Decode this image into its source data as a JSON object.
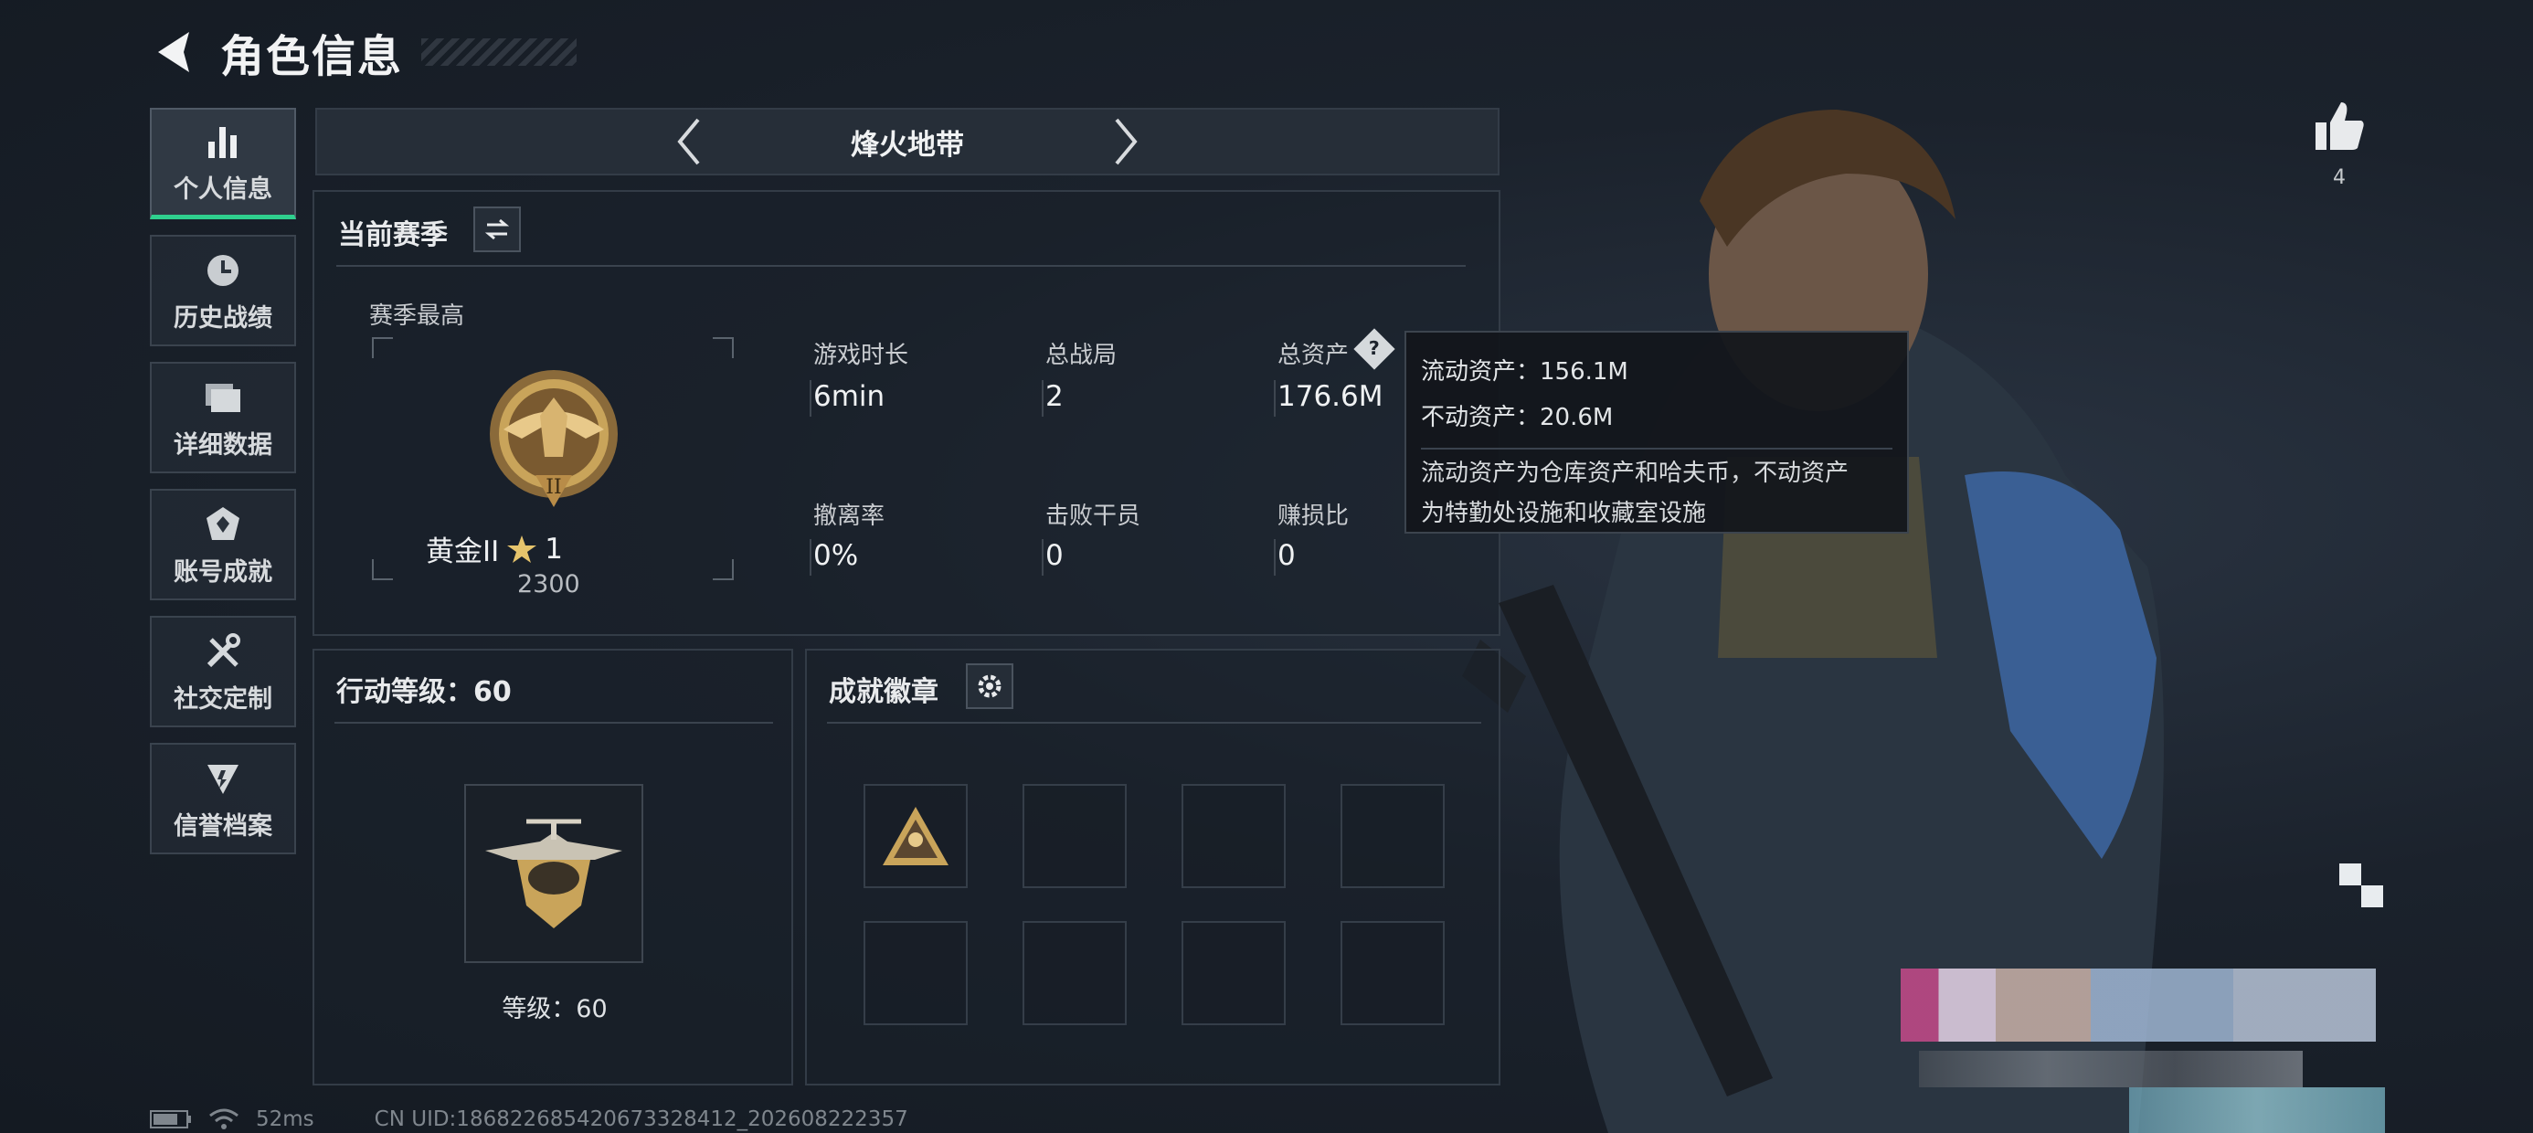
{
  "header": {
    "title": "角色信息"
  },
  "sidebar": {
    "items": [
      {
        "label": "个人信息",
        "icon": "bar-chart-icon",
        "active": true
      },
      {
        "label": "历史战绩",
        "icon": "history-clock-icon",
        "active": false
      },
      {
        "label": "详细数据",
        "icon": "folder-icon",
        "active": false
      },
      {
        "label": "账号成就",
        "icon": "achievement-icon",
        "active": false
      },
      {
        "label": "社交定制",
        "icon": "tools-icon",
        "active": false
      },
      {
        "label": "信誉档案",
        "icon": "credit-shield-icon",
        "active": false
      }
    ]
  },
  "mode": {
    "label": "烽火地带"
  },
  "season": {
    "title": "当前赛季",
    "best_label": "赛季最高",
    "rank_name": "黄金II",
    "rank_stars": "1",
    "rank_score": "2300",
    "stats": [
      {
        "label": "游戏时长",
        "value": "6min"
      },
      {
        "label": "总战局",
        "value": "2"
      },
      {
        "label": "总资产",
        "value": "176.6M"
      },
      {
        "label": "撤离率",
        "value": "0%"
      },
      {
        "label": "击败干员",
        "value": "0"
      },
      {
        "label": "赚损比",
        "value": "0"
      }
    ]
  },
  "tooltip": {
    "liquid": "流动资产：156.1M",
    "fixed": "不动资产：20.6M",
    "desc_line1": "流动资产为仓库资产和哈夫币，不动资产",
    "desc_line2": "为特勤处设施和收藏室设施"
  },
  "level": {
    "title": "行动等级：60",
    "caption": "等级：60"
  },
  "badges": {
    "title": "成就徽章"
  },
  "likes": {
    "count": "4"
  },
  "footer": {
    "ping": "52ms",
    "uid": "CN UID:186822685420673328412_202608222357"
  },
  "colors": {
    "accent": "#2fd08e",
    "panel_border": "#333c47",
    "gold": "#c9a45a"
  }
}
